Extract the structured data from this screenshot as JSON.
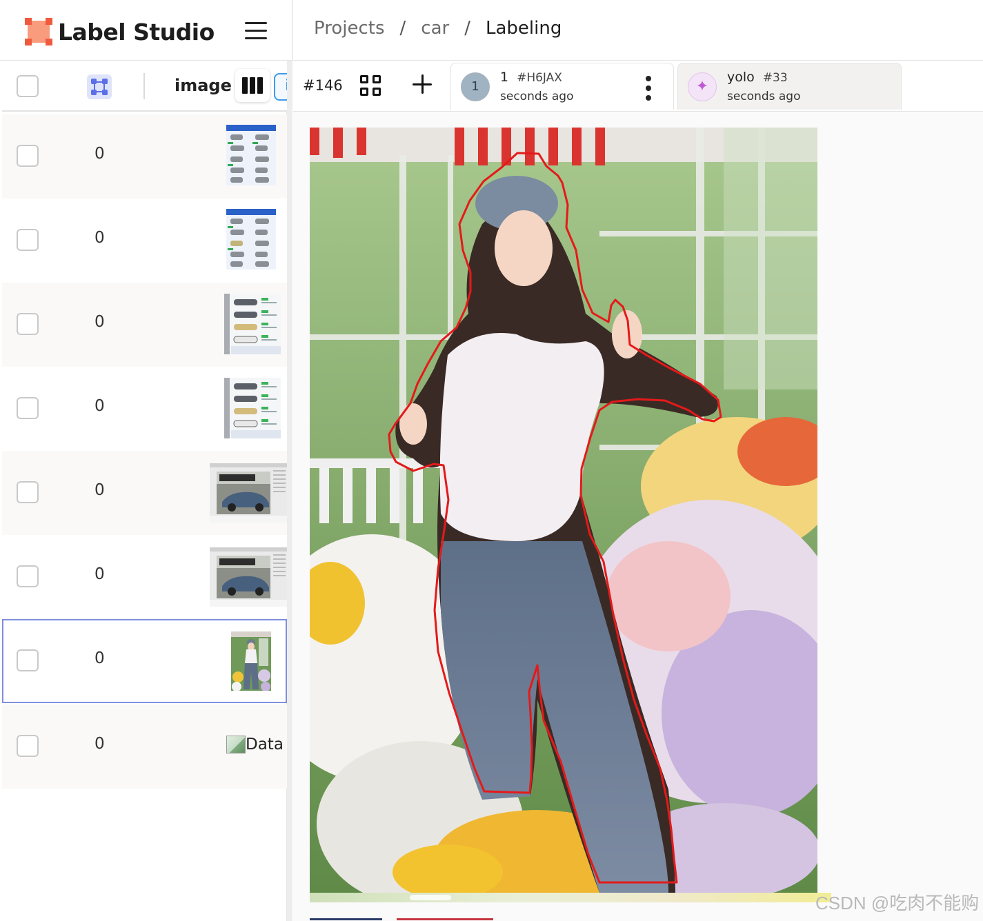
{
  "app": {
    "name": "Label Studio",
    "brand_color": "#f05a3c"
  },
  "breadcrumb": [
    {
      "label": "Projects"
    },
    {
      "label": "car"
    },
    {
      "label": "Labeling"
    }
  ],
  "breadcrumb_separator": "/",
  "data_manager": {
    "columns": {
      "image_label": "image",
      "info_label": "i"
    },
    "rows": [
      {
        "annotations": "0",
        "thumb": "car-chart"
      },
      {
        "annotations": "0",
        "thumb": "car-chart"
      },
      {
        "annotations": "0",
        "thumb": "car-list"
      },
      {
        "annotations": "0",
        "thumb": "car-list"
      },
      {
        "annotations": "0",
        "thumb": "car-post"
      },
      {
        "annotations": "0",
        "thumb": "car-post"
      },
      {
        "annotations": "0",
        "thumb": "person-photo",
        "selected": true
      },
      {
        "annotations": "0",
        "thumb": "broken",
        "alt": "Data"
      }
    ]
  },
  "task": {
    "id": "#146"
  },
  "annotations": [
    {
      "avatar": "1",
      "user": "1",
      "id": "#H6JAX",
      "time": "seconds ago",
      "active": true
    },
    {
      "avatar_icon": "sparkle-icon",
      "user": "yolo",
      "id": "#33",
      "time": "seconds ago",
      "active": false
    }
  ],
  "region": {
    "type": "polygon",
    "color": "#e41a1a",
    "label_target": "person"
  },
  "watermark": "CSDN @吃肉不能购"
}
